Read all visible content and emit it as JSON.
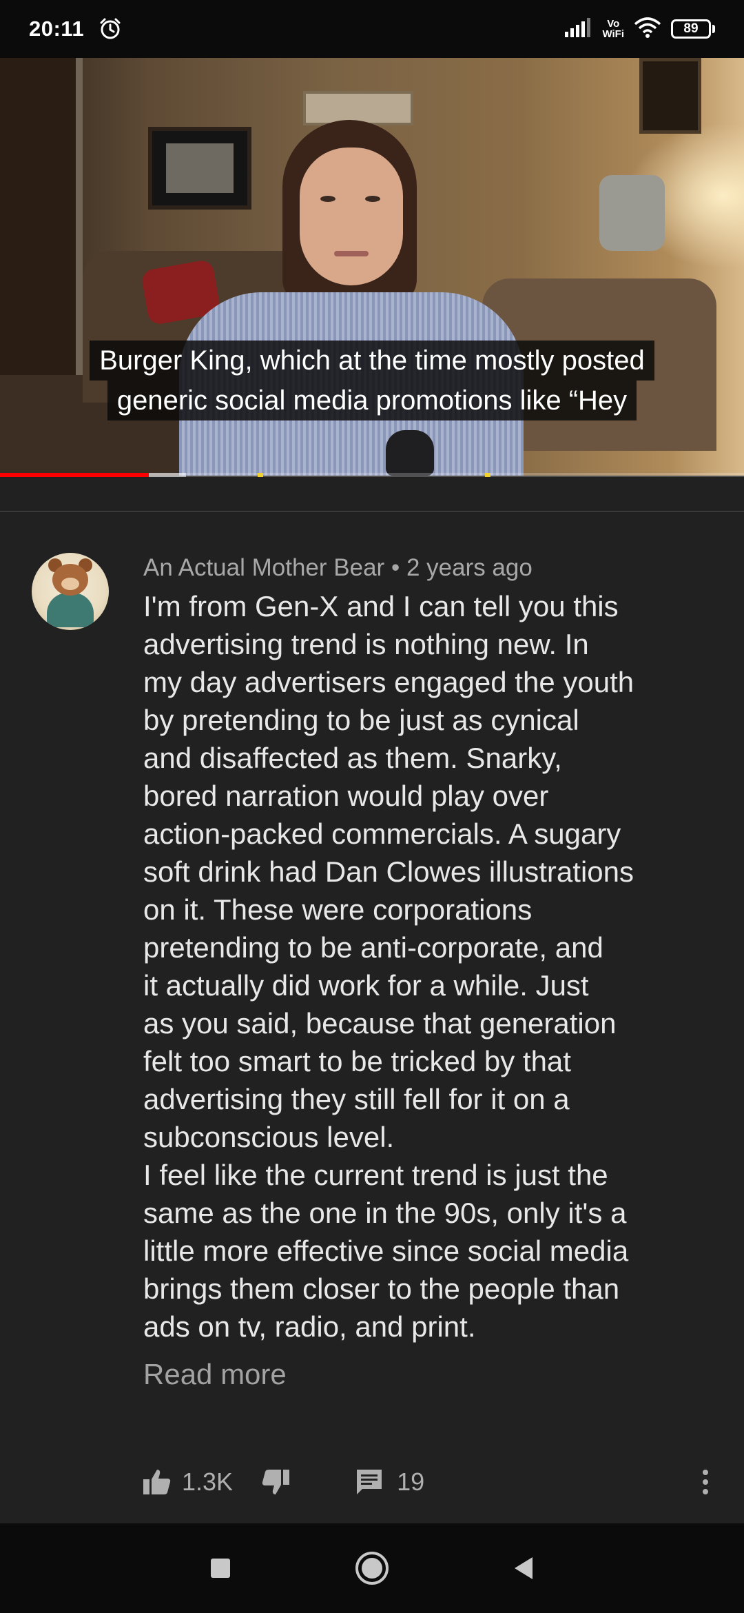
{
  "status_bar": {
    "time": "20:11",
    "vowifi_line1": "Vo",
    "vowifi_line2": "WiFi",
    "battery": "89"
  },
  "video": {
    "caption_line1": "Burger King, which at the time mostly posted",
    "caption_line2": "generic social media promotions like “Hey",
    "progress_played_fraction": 0.2,
    "progress_buffered_fraction": 0.25,
    "colors": {
      "progress": "#ff0000",
      "marker": "#f2d22e"
    }
  },
  "comment": {
    "author": "An Actual Mother Bear",
    "separator": "•",
    "time_ago": "2 years ago",
    "text": "I'm from Gen-X and I can tell you this\nadvertising trend is nothing new. In\nmy day advertisers engaged the youth\nby pretending to be just as cynical\nand disaffected as them. Snarky,\nbored narration would play over\naction-packed commercials. A sugary\nsoft drink had Dan Clowes illustrations\non it. These were corporations\npretending to be anti-corporate, and\nit actually did work for a while. Just\nas you said, because that generation\nfelt too smart to be tricked by that\nadvertising they still fell for it on a\nsubconscious level.\nI feel like the current trend is just the\nsame as the one in the 90s, only it's a\nlittle more effective since social media\nbrings them closer to the people than\nads on tv, radio, and print.",
    "read_more": "Read more",
    "likes": "1.3K",
    "replies": "19"
  },
  "icons": {
    "status": [
      "alarm-icon",
      "signal-icon",
      "wifi-icon",
      "battery-icon"
    ],
    "actions": [
      "thumbs-up-icon",
      "thumbs-down-icon",
      "reply-icon",
      "more-vert-icon"
    ],
    "nav": [
      "recents-icon",
      "home-icon",
      "back-icon"
    ]
  }
}
